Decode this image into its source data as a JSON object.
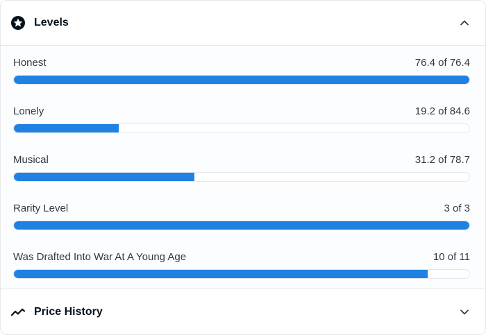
{
  "levels_section": {
    "title": "Levels",
    "icon": "star-circle-icon",
    "chevron": "chevron-up-icon",
    "accent": "#2081e2",
    "items": [
      {
        "name": "Honest",
        "value_text": "76.4 of 76.4",
        "fraction": 1.0
      },
      {
        "name": "Lonely",
        "value_text": "19.2 of 84.6",
        "fraction": 0.2296
      },
      {
        "name": "Musical",
        "value_text": "31.2 of 78.7",
        "fraction": 0.3964
      },
      {
        "name": "Rarity Level",
        "value_text": "3 of 3",
        "fraction": 1.0
      },
      {
        "name": "Was Drafted Into War At A Young Age",
        "value_text": "10 of 11",
        "fraction": 0.909
      }
    ]
  },
  "price_history_section": {
    "title": "Price History",
    "icon": "trend-line-icon",
    "chevron": "chevron-down-icon"
  }
}
